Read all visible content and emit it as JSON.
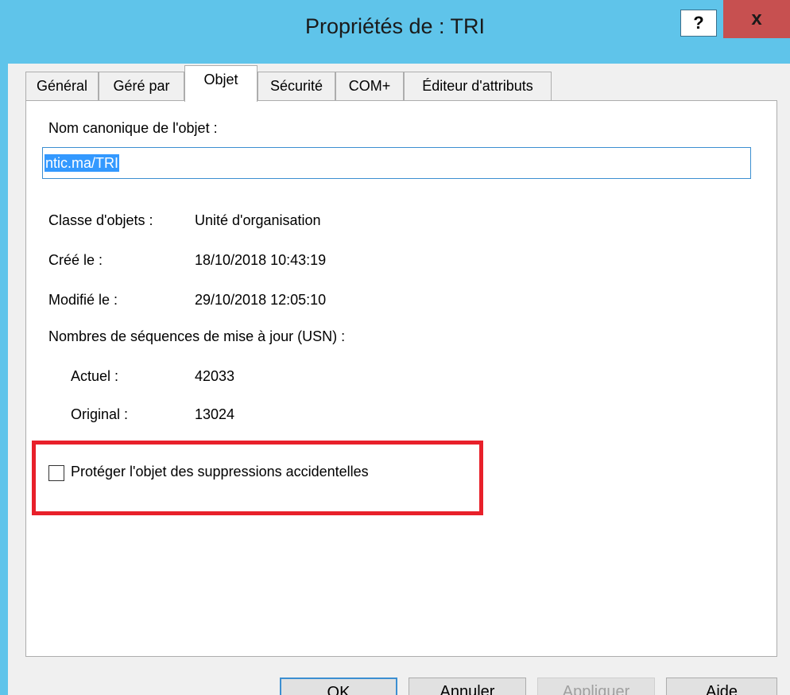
{
  "window": {
    "title": "Propriétés de : TRI",
    "help_label": "?",
    "close_label": "x"
  },
  "tabs": [
    {
      "label": "Général"
    },
    {
      "label": "Géré par"
    },
    {
      "label": "Objet"
    },
    {
      "label": "Sécurité"
    },
    {
      "label": "COM+"
    },
    {
      "label": "Éditeur d'attributs"
    }
  ],
  "active_tab": "Objet",
  "object": {
    "canonical_name_label": "Nom canonique de l'objet :",
    "canonical_name_value": "ntic.ma/TRI",
    "class_label": "Classe d'objets :",
    "class_value": "Unité d'organisation",
    "created_label": "Créé le :",
    "created_value": "18/10/2018 10:43:19",
    "modified_label": "Modifié le :",
    "modified_value": "29/10/2018 12:05:10",
    "usn_label": "Nombres de séquences de mise à jour (USN) :",
    "current_label": "Actuel :",
    "current_value": "42033",
    "original_label": "Original :",
    "original_value": "13024",
    "protect_label": "Protéger l'objet des suppressions accidentelles",
    "protect_checked": false
  },
  "buttons": {
    "ok": "OK",
    "cancel": "Annuler",
    "apply": "Appliquer",
    "help": "Aide"
  },
  "colors": {
    "titlebar": "#5fc4ea",
    "close": "#c75050",
    "highlight_box": "#e8202a",
    "selection": "#3399ff"
  }
}
